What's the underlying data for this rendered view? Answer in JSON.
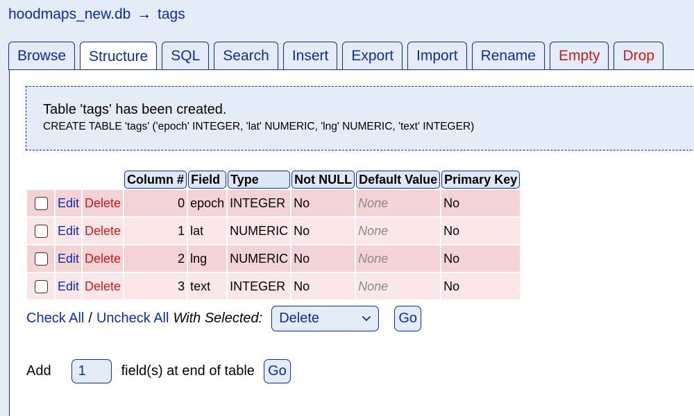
{
  "breadcrumb": {
    "db": "hoodmaps_new.db",
    "arrow": "→",
    "table": "tags"
  },
  "tabs": [
    {
      "label": "Browse"
    },
    {
      "label": "Structure"
    },
    {
      "label": "SQL"
    },
    {
      "label": "Search"
    },
    {
      "label": "Insert"
    },
    {
      "label": "Export"
    },
    {
      "label": "Import"
    },
    {
      "label": "Rename"
    },
    {
      "label": "Empty"
    },
    {
      "label": "Drop"
    }
  ],
  "message": {
    "title": "Table 'tags' has been created.",
    "sql": "CREATE TABLE 'tags' ('epoch' INTEGER, 'lat' NUMERIC, 'lng' NUMERIC, 'text' INTEGER)"
  },
  "table": {
    "headers": [
      "Column #",
      "Field",
      "Type",
      "Not NULL",
      "Default Value",
      "Primary Key"
    ],
    "rows": [
      {
        "edit": "Edit",
        "delete": "Delete",
        "col": "0",
        "field": "epoch",
        "type": "INTEGER",
        "notnull": "No",
        "default": "None",
        "pk": "No"
      },
      {
        "edit": "Edit",
        "delete": "Delete",
        "col": "1",
        "field": "lat",
        "type": "NUMERIC",
        "notnull": "No",
        "default": "None",
        "pk": "No"
      },
      {
        "edit": "Edit",
        "delete": "Delete",
        "col": "2",
        "field": "lng",
        "type": "NUMERIC",
        "notnull": "No",
        "default": "None",
        "pk": "No"
      },
      {
        "edit": "Edit",
        "delete": "Delete",
        "col": "3",
        "field": "text",
        "type": "INTEGER",
        "notnull": "No",
        "default": "None",
        "pk": "No"
      }
    ]
  },
  "selection": {
    "check_all": "Check All",
    "separator": "/",
    "uncheck_all": "Uncheck All",
    "with_selected": "With Selected:",
    "action_value": "Delete",
    "go": "Go"
  },
  "add_field": {
    "add": "Add",
    "count_value": "1",
    "suffix": "field(s) at end of table",
    "go": "Go"
  },
  "colors": {
    "link": "#0b2cae",
    "danger": "#d01818",
    "background": "#e4ecf7",
    "row_odd": "#f4d3d6",
    "row_even": "#fbe6e8"
  }
}
